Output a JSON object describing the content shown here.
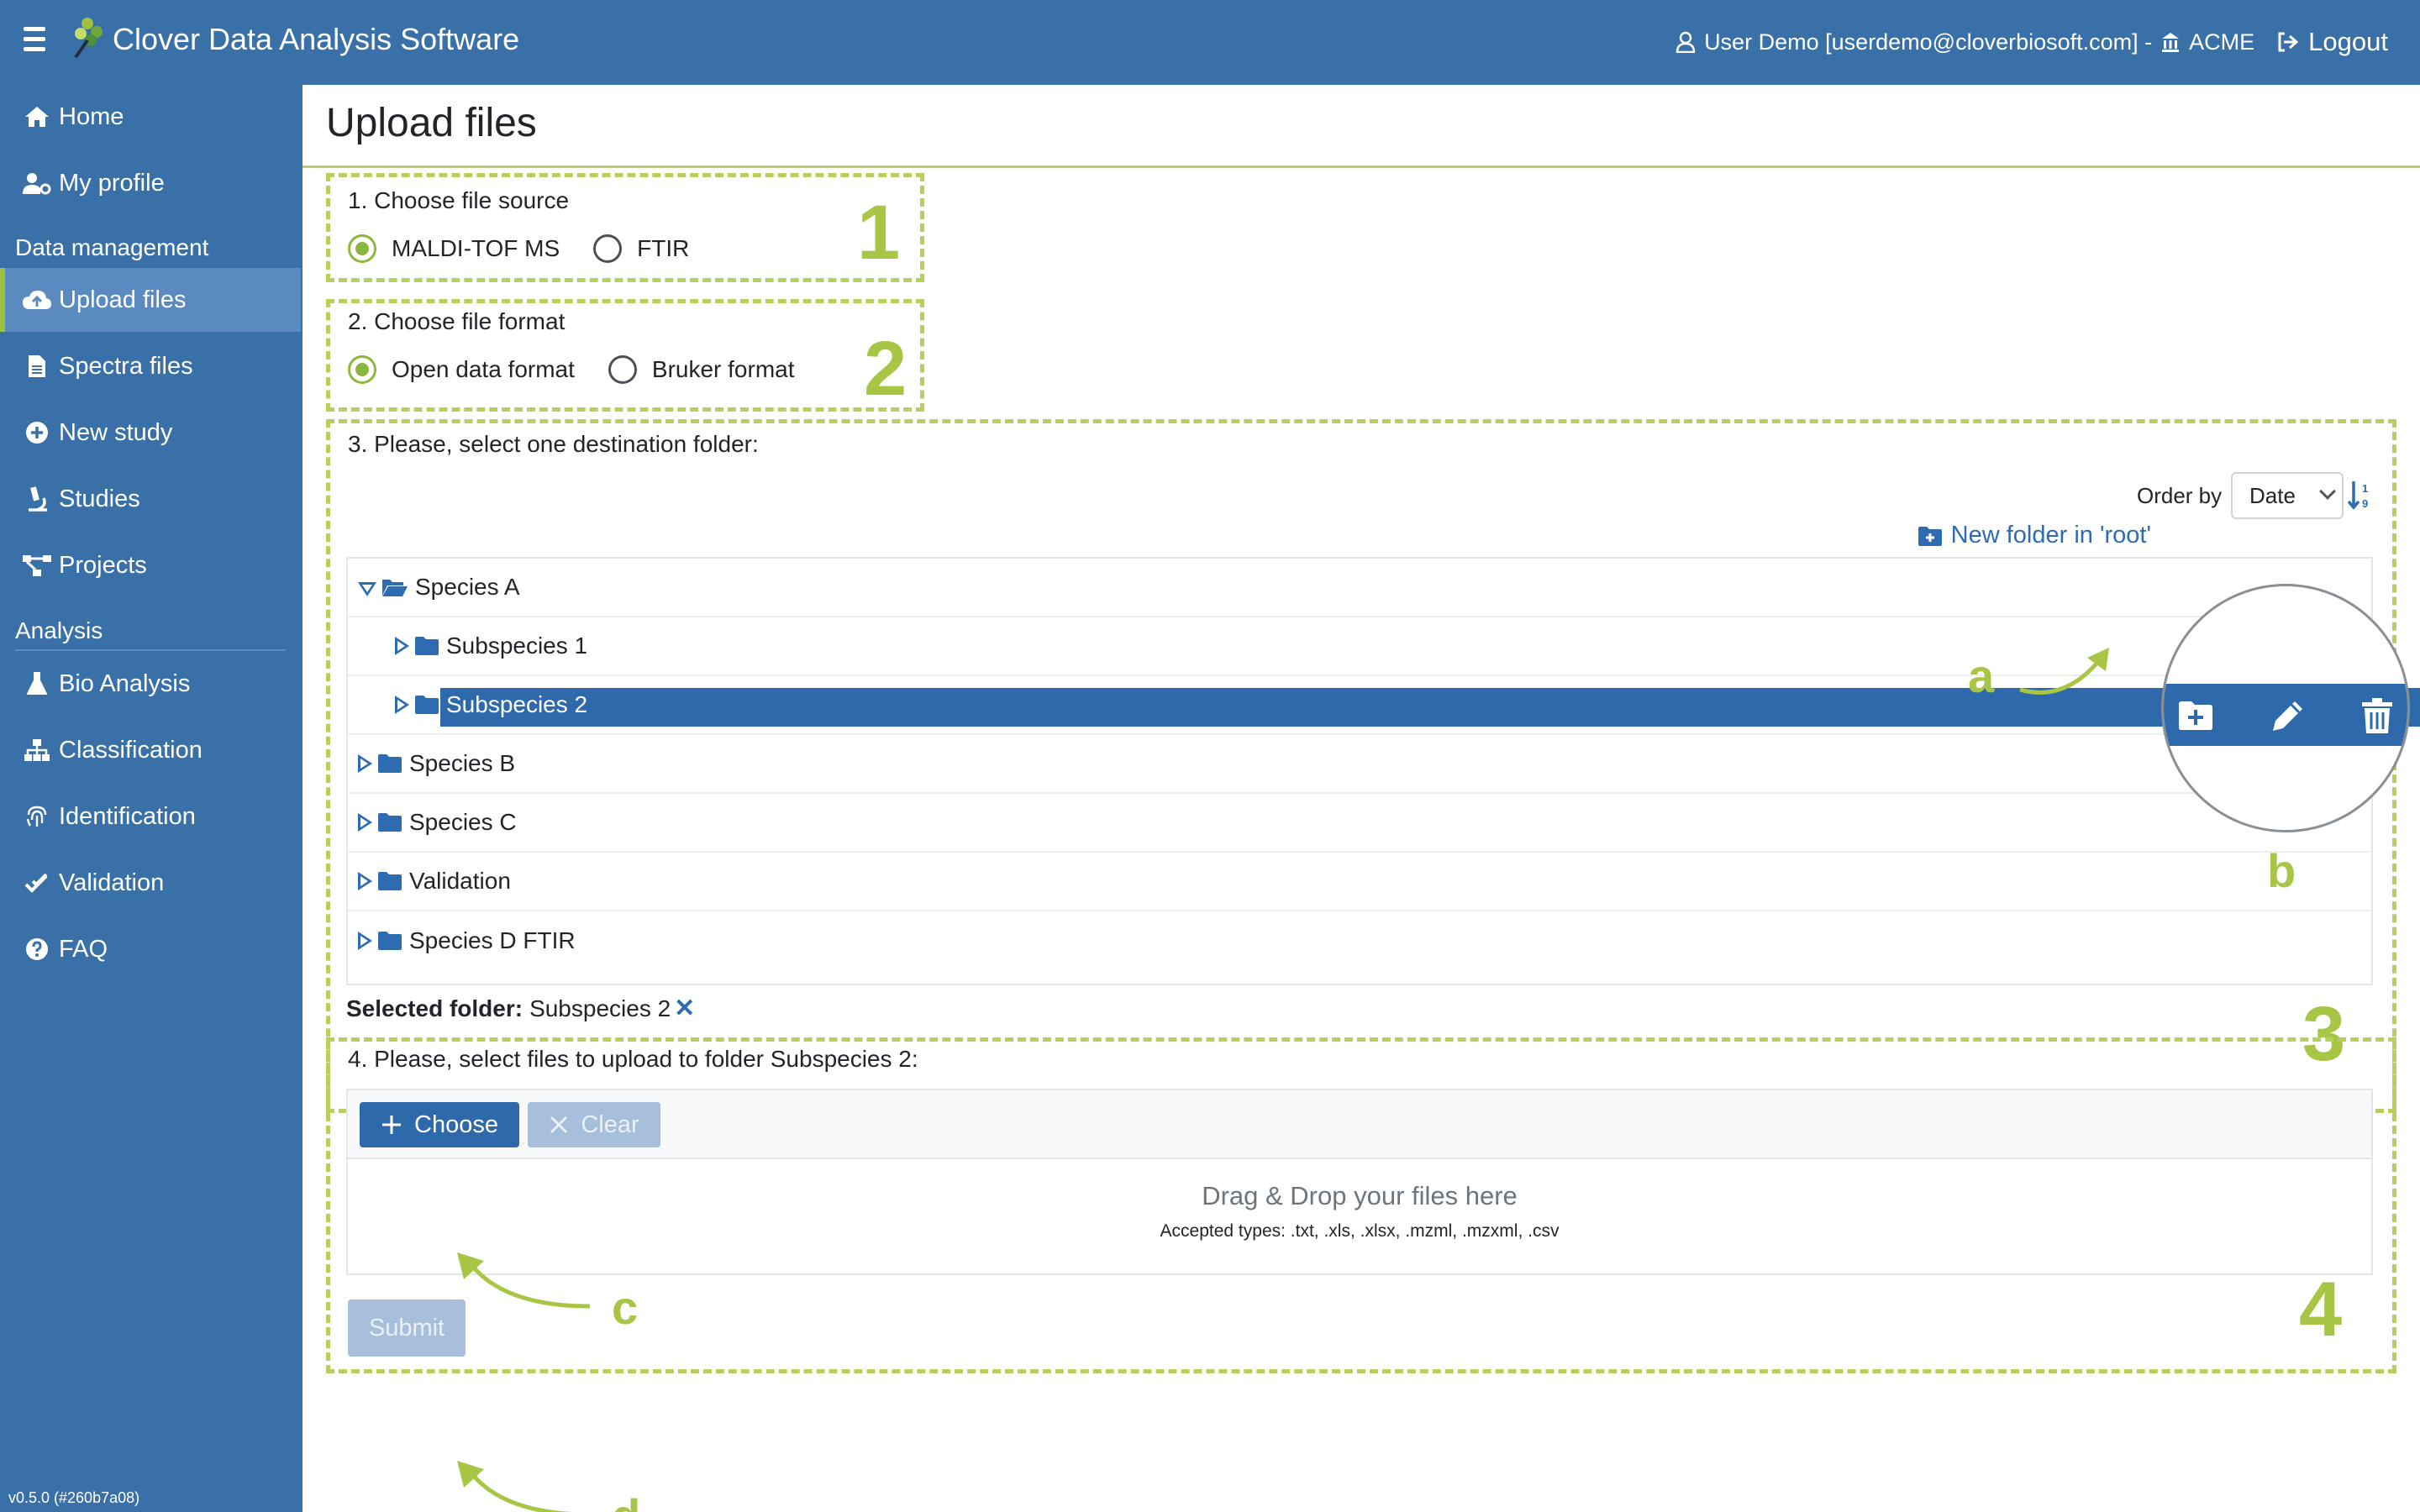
{
  "header": {
    "app_title": "Clover Data Analysis Software",
    "user_text": "User Demo [userdemo@cloverbiosoft.com] - ",
    "org": "ACME",
    "logout": "Logout"
  },
  "sidebar": {
    "items": [
      {
        "label": "Home",
        "icon": "home-icon"
      },
      {
        "label": "My profile",
        "icon": "user-cog-icon"
      }
    ],
    "section_data": "Data management",
    "data_items": [
      {
        "label": "Upload files",
        "icon": "cloud-upload-icon",
        "active": true
      },
      {
        "label": "Spectra files",
        "icon": "file-icon"
      },
      {
        "label": "New study",
        "icon": "plus-circle-icon"
      },
      {
        "label": "Studies",
        "icon": "microscope-icon"
      },
      {
        "label": "Projects",
        "icon": "project-diagram-icon"
      }
    ],
    "section_analysis": "Analysis",
    "analysis_items": [
      {
        "label": "Bio Analysis",
        "icon": "flask-icon"
      },
      {
        "label": "Classification",
        "icon": "sitemap-icon"
      },
      {
        "label": "Identification",
        "icon": "fingerprint-icon"
      },
      {
        "label": "Validation",
        "icon": "check-double-icon"
      },
      {
        "label": "FAQ",
        "icon": "question-circle-icon"
      }
    ],
    "version": "v0.5.0 (#260b7a08)"
  },
  "main": {
    "page_title": "Upload files",
    "step1": {
      "label": "1. Choose file source",
      "options": [
        "MALDI-TOF MS",
        "FTIR"
      ],
      "selected": "MALDI-TOF MS"
    },
    "step2": {
      "label": "2. Choose file format",
      "options": [
        "Open data format",
        "Bruker format"
      ],
      "selected": "Open data format"
    },
    "step3": {
      "label": "3. Please, select one destination folder:",
      "order_by_label": "Order by",
      "order_by_value": "Date",
      "new_folder": "New folder in 'root'",
      "tree": [
        {
          "label": "Species A",
          "level": 0,
          "expanded": true,
          "open_folder": true
        },
        {
          "label": "Subspecies 1",
          "level": 1
        },
        {
          "label": "Subspecies 2",
          "level": 1,
          "selected": true
        },
        {
          "label": "Species B",
          "level": 0
        },
        {
          "label": "Species C",
          "level": 0
        },
        {
          "label": "Validation",
          "level": 0
        },
        {
          "label": "Species D FTIR",
          "level": 0
        }
      ],
      "selected_label": "Selected folder:",
      "selected_value": "Subspecies 2",
      "clear_mark": "✕"
    },
    "step4": {
      "label": "4. Please, select files to upload to folder Subspecies 2:",
      "choose": "Choose",
      "clear": "Clear",
      "drop_text": "Drag & Drop your files here",
      "accepted": "Accepted types: .txt, .xls, .xlsx, .mzml, .mzxml, .csv"
    },
    "submit": "Submit"
  },
  "annotations": {
    "numbers": [
      "1",
      "2",
      "3",
      "4"
    ],
    "letters": [
      "a",
      "b",
      "c",
      "d"
    ],
    "color": "#a8c545"
  },
  "colors": {
    "primary": "#3a70a8",
    "selected_row": "#2e6aab",
    "accent_green": "#8bb83c",
    "annotation_green": "#b5d05d"
  }
}
